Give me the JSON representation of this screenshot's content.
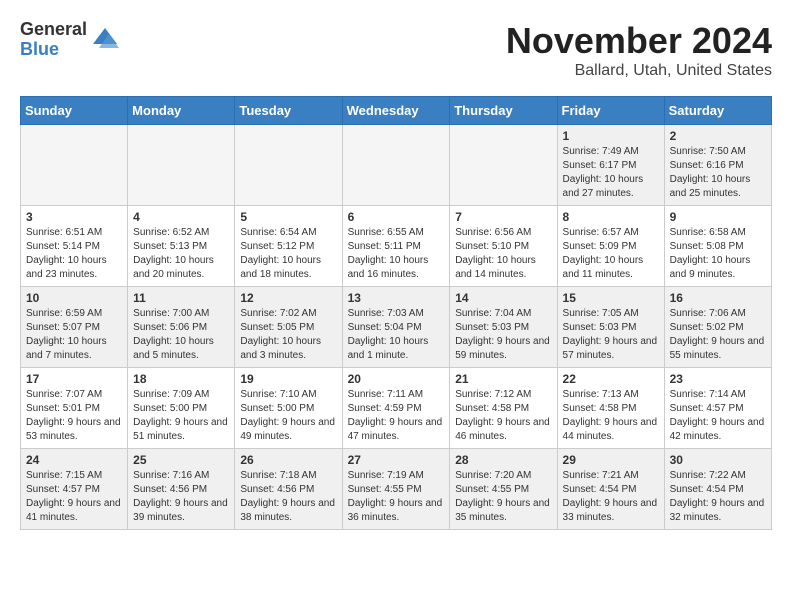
{
  "logo": {
    "general": "General",
    "blue": "Blue"
  },
  "header": {
    "month": "November 2024",
    "location": "Ballard, Utah, United States"
  },
  "days_of_week": [
    "Sunday",
    "Monday",
    "Tuesday",
    "Wednesday",
    "Thursday",
    "Friday",
    "Saturday"
  ],
  "weeks": [
    [
      {
        "day": "",
        "info": ""
      },
      {
        "day": "",
        "info": ""
      },
      {
        "day": "",
        "info": ""
      },
      {
        "day": "",
        "info": ""
      },
      {
        "day": "",
        "info": ""
      },
      {
        "day": "1",
        "info": "Sunrise: 7:49 AM\nSunset: 6:17 PM\nDaylight: 10 hours and 27 minutes."
      },
      {
        "day": "2",
        "info": "Sunrise: 7:50 AM\nSunset: 6:16 PM\nDaylight: 10 hours and 25 minutes."
      }
    ],
    [
      {
        "day": "3",
        "info": "Sunrise: 6:51 AM\nSunset: 5:14 PM\nDaylight: 10 hours and 23 minutes."
      },
      {
        "day": "4",
        "info": "Sunrise: 6:52 AM\nSunset: 5:13 PM\nDaylight: 10 hours and 20 minutes."
      },
      {
        "day": "5",
        "info": "Sunrise: 6:54 AM\nSunset: 5:12 PM\nDaylight: 10 hours and 18 minutes."
      },
      {
        "day": "6",
        "info": "Sunrise: 6:55 AM\nSunset: 5:11 PM\nDaylight: 10 hours and 16 minutes."
      },
      {
        "day": "7",
        "info": "Sunrise: 6:56 AM\nSunset: 5:10 PM\nDaylight: 10 hours and 14 minutes."
      },
      {
        "day": "8",
        "info": "Sunrise: 6:57 AM\nSunset: 5:09 PM\nDaylight: 10 hours and 11 minutes."
      },
      {
        "day": "9",
        "info": "Sunrise: 6:58 AM\nSunset: 5:08 PM\nDaylight: 10 hours and 9 minutes."
      }
    ],
    [
      {
        "day": "10",
        "info": "Sunrise: 6:59 AM\nSunset: 5:07 PM\nDaylight: 10 hours and 7 minutes."
      },
      {
        "day": "11",
        "info": "Sunrise: 7:00 AM\nSunset: 5:06 PM\nDaylight: 10 hours and 5 minutes."
      },
      {
        "day": "12",
        "info": "Sunrise: 7:02 AM\nSunset: 5:05 PM\nDaylight: 10 hours and 3 minutes."
      },
      {
        "day": "13",
        "info": "Sunrise: 7:03 AM\nSunset: 5:04 PM\nDaylight: 10 hours and 1 minute."
      },
      {
        "day": "14",
        "info": "Sunrise: 7:04 AM\nSunset: 5:03 PM\nDaylight: 9 hours and 59 minutes."
      },
      {
        "day": "15",
        "info": "Sunrise: 7:05 AM\nSunset: 5:03 PM\nDaylight: 9 hours and 57 minutes."
      },
      {
        "day": "16",
        "info": "Sunrise: 7:06 AM\nSunset: 5:02 PM\nDaylight: 9 hours and 55 minutes."
      }
    ],
    [
      {
        "day": "17",
        "info": "Sunrise: 7:07 AM\nSunset: 5:01 PM\nDaylight: 9 hours and 53 minutes."
      },
      {
        "day": "18",
        "info": "Sunrise: 7:09 AM\nSunset: 5:00 PM\nDaylight: 9 hours and 51 minutes."
      },
      {
        "day": "19",
        "info": "Sunrise: 7:10 AM\nSunset: 5:00 PM\nDaylight: 9 hours and 49 minutes."
      },
      {
        "day": "20",
        "info": "Sunrise: 7:11 AM\nSunset: 4:59 PM\nDaylight: 9 hours and 47 minutes."
      },
      {
        "day": "21",
        "info": "Sunrise: 7:12 AM\nSunset: 4:58 PM\nDaylight: 9 hours and 46 minutes."
      },
      {
        "day": "22",
        "info": "Sunrise: 7:13 AM\nSunset: 4:58 PM\nDaylight: 9 hours and 44 minutes."
      },
      {
        "day": "23",
        "info": "Sunrise: 7:14 AM\nSunset: 4:57 PM\nDaylight: 9 hours and 42 minutes."
      }
    ],
    [
      {
        "day": "24",
        "info": "Sunrise: 7:15 AM\nSunset: 4:57 PM\nDaylight: 9 hours and 41 minutes."
      },
      {
        "day": "25",
        "info": "Sunrise: 7:16 AM\nSunset: 4:56 PM\nDaylight: 9 hours and 39 minutes."
      },
      {
        "day": "26",
        "info": "Sunrise: 7:18 AM\nSunset: 4:56 PM\nDaylight: 9 hours and 38 minutes."
      },
      {
        "day": "27",
        "info": "Sunrise: 7:19 AM\nSunset: 4:55 PM\nDaylight: 9 hours and 36 minutes."
      },
      {
        "day": "28",
        "info": "Sunrise: 7:20 AM\nSunset: 4:55 PM\nDaylight: 9 hours and 35 minutes."
      },
      {
        "day": "29",
        "info": "Sunrise: 7:21 AM\nSunset: 4:54 PM\nDaylight: 9 hours and 33 minutes."
      },
      {
        "day": "30",
        "info": "Sunrise: 7:22 AM\nSunset: 4:54 PM\nDaylight: 9 hours and 32 minutes."
      }
    ]
  ]
}
